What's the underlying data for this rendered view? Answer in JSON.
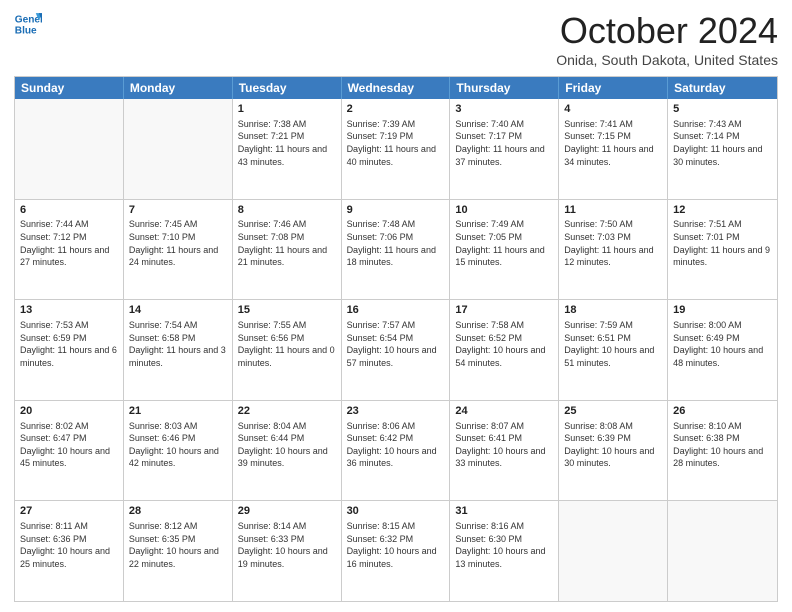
{
  "header": {
    "logo_line1": "General",
    "logo_line2": "Blue",
    "month_title": "October 2024",
    "location": "Onida, South Dakota, United States"
  },
  "days_of_week": [
    "Sunday",
    "Monday",
    "Tuesday",
    "Wednesday",
    "Thursday",
    "Friday",
    "Saturday"
  ],
  "weeks": [
    [
      {
        "day": "",
        "sunrise": "",
        "sunset": "",
        "daylight": "",
        "empty": true
      },
      {
        "day": "",
        "sunrise": "",
        "sunset": "",
        "daylight": "",
        "empty": true
      },
      {
        "day": "1",
        "sunrise": "Sunrise: 7:38 AM",
        "sunset": "Sunset: 7:21 PM",
        "daylight": "Daylight: 11 hours and 43 minutes."
      },
      {
        "day": "2",
        "sunrise": "Sunrise: 7:39 AM",
        "sunset": "Sunset: 7:19 PM",
        "daylight": "Daylight: 11 hours and 40 minutes."
      },
      {
        "day": "3",
        "sunrise": "Sunrise: 7:40 AM",
        "sunset": "Sunset: 7:17 PM",
        "daylight": "Daylight: 11 hours and 37 minutes."
      },
      {
        "day": "4",
        "sunrise": "Sunrise: 7:41 AM",
        "sunset": "Sunset: 7:15 PM",
        "daylight": "Daylight: 11 hours and 34 minutes."
      },
      {
        "day": "5",
        "sunrise": "Sunrise: 7:43 AM",
        "sunset": "Sunset: 7:14 PM",
        "daylight": "Daylight: 11 hours and 30 minutes."
      }
    ],
    [
      {
        "day": "6",
        "sunrise": "Sunrise: 7:44 AM",
        "sunset": "Sunset: 7:12 PM",
        "daylight": "Daylight: 11 hours and 27 minutes."
      },
      {
        "day": "7",
        "sunrise": "Sunrise: 7:45 AM",
        "sunset": "Sunset: 7:10 PM",
        "daylight": "Daylight: 11 hours and 24 minutes."
      },
      {
        "day": "8",
        "sunrise": "Sunrise: 7:46 AM",
        "sunset": "Sunset: 7:08 PM",
        "daylight": "Daylight: 11 hours and 21 minutes."
      },
      {
        "day": "9",
        "sunrise": "Sunrise: 7:48 AM",
        "sunset": "Sunset: 7:06 PM",
        "daylight": "Daylight: 11 hours and 18 minutes."
      },
      {
        "day": "10",
        "sunrise": "Sunrise: 7:49 AM",
        "sunset": "Sunset: 7:05 PM",
        "daylight": "Daylight: 11 hours and 15 minutes."
      },
      {
        "day": "11",
        "sunrise": "Sunrise: 7:50 AM",
        "sunset": "Sunset: 7:03 PM",
        "daylight": "Daylight: 11 hours and 12 minutes."
      },
      {
        "day": "12",
        "sunrise": "Sunrise: 7:51 AM",
        "sunset": "Sunset: 7:01 PM",
        "daylight": "Daylight: 11 hours and 9 minutes."
      }
    ],
    [
      {
        "day": "13",
        "sunrise": "Sunrise: 7:53 AM",
        "sunset": "Sunset: 6:59 PM",
        "daylight": "Daylight: 11 hours and 6 minutes."
      },
      {
        "day": "14",
        "sunrise": "Sunrise: 7:54 AM",
        "sunset": "Sunset: 6:58 PM",
        "daylight": "Daylight: 11 hours and 3 minutes."
      },
      {
        "day": "15",
        "sunrise": "Sunrise: 7:55 AM",
        "sunset": "Sunset: 6:56 PM",
        "daylight": "Daylight: 11 hours and 0 minutes."
      },
      {
        "day": "16",
        "sunrise": "Sunrise: 7:57 AM",
        "sunset": "Sunset: 6:54 PM",
        "daylight": "Daylight: 10 hours and 57 minutes."
      },
      {
        "day": "17",
        "sunrise": "Sunrise: 7:58 AM",
        "sunset": "Sunset: 6:52 PM",
        "daylight": "Daylight: 10 hours and 54 minutes."
      },
      {
        "day": "18",
        "sunrise": "Sunrise: 7:59 AM",
        "sunset": "Sunset: 6:51 PM",
        "daylight": "Daylight: 10 hours and 51 minutes."
      },
      {
        "day": "19",
        "sunrise": "Sunrise: 8:00 AM",
        "sunset": "Sunset: 6:49 PM",
        "daylight": "Daylight: 10 hours and 48 minutes."
      }
    ],
    [
      {
        "day": "20",
        "sunrise": "Sunrise: 8:02 AM",
        "sunset": "Sunset: 6:47 PM",
        "daylight": "Daylight: 10 hours and 45 minutes."
      },
      {
        "day": "21",
        "sunrise": "Sunrise: 8:03 AM",
        "sunset": "Sunset: 6:46 PM",
        "daylight": "Daylight: 10 hours and 42 minutes."
      },
      {
        "day": "22",
        "sunrise": "Sunrise: 8:04 AM",
        "sunset": "Sunset: 6:44 PM",
        "daylight": "Daylight: 10 hours and 39 minutes."
      },
      {
        "day": "23",
        "sunrise": "Sunrise: 8:06 AM",
        "sunset": "Sunset: 6:42 PM",
        "daylight": "Daylight: 10 hours and 36 minutes."
      },
      {
        "day": "24",
        "sunrise": "Sunrise: 8:07 AM",
        "sunset": "Sunset: 6:41 PM",
        "daylight": "Daylight: 10 hours and 33 minutes."
      },
      {
        "day": "25",
        "sunrise": "Sunrise: 8:08 AM",
        "sunset": "Sunset: 6:39 PM",
        "daylight": "Daylight: 10 hours and 30 minutes."
      },
      {
        "day": "26",
        "sunrise": "Sunrise: 8:10 AM",
        "sunset": "Sunset: 6:38 PM",
        "daylight": "Daylight: 10 hours and 28 minutes."
      }
    ],
    [
      {
        "day": "27",
        "sunrise": "Sunrise: 8:11 AM",
        "sunset": "Sunset: 6:36 PM",
        "daylight": "Daylight: 10 hours and 25 minutes."
      },
      {
        "day": "28",
        "sunrise": "Sunrise: 8:12 AM",
        "sunset": "Sunset: 6:35 PM",
        "daylight": "Daylight: 10 hours and 22 minutes."
      },
      {
        "day": "29",
        "sunrise": "Sunrise: 8:14 AM",
        "sunset": "Sunset: 6:33 PM",
        "daylight": "Daylight: 10 hours and 19 minutes."
      },
      {
        "day": "30",
        "sunrise": "Sunrise: 8:15 AM",
        "sunset": "Sunset: 6:32 PM",
        "daylight": "Daylight: 10 hours and 16 minutes."
      },
      {
        "day": "31",
        "sunrise": "Sunrise: 8:16 AM",
        "sunset": "Sunset: 6:30 PM",
        "daylight": "Daylight: 10 hours and 13 minutes."
      },
      {
        "day": "",
        "sunrise": "",
        "sunset": "",
        "daylight": "",
        "empty": true
      },
      {
        "day": "",
        "sunrise": "",
        "sunset": "",
        "daylight": "",
        "empty": true
      }
    ]
  ]
}
